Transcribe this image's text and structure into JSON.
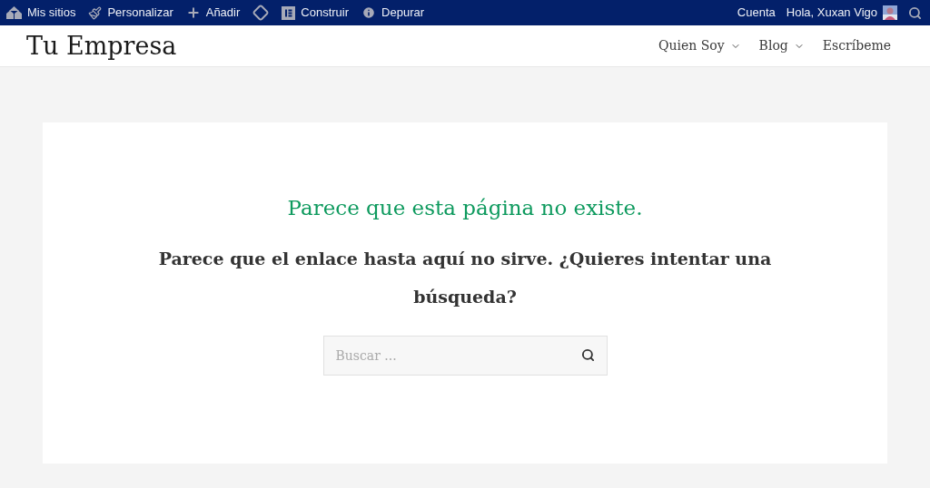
{
  "admin_bar": {
    "left": [
      {
        "kind": "sites",
        "label": "Mis sitios"
      },
      {
        "kind": "brush",
        "label": "Personalizar"
      },
      {
        "kind": "plus",
        "label": "Añadir"
      },
      {
        "kind": "diamond"
      },
      {
        "kind": "builder",
        "label": "Construir"
      },
      {
        "kind": "info",
        "label": "Depurar"
      }
    ],
    "right": [
      {
        "kind": "text",
        "label": "Cuenta"
      },
      {
        "kind": "user",
        "label": "Hola, Xuxan Vigo"
      },
      {
        "kind": "search"
      }
    ]
  },
  "header": {
    "site_title": "Tu Empresa",
    "nav": [
      {
        "label": "Quien Soy",
        "dropdown": true
      },
      {
        "label": "Blog",
        "dropdown": true
      },
      {
        "label": "Escríbeme",
        "dropdown": false
      }
    ]
  },
  "content": {
    "title": "Parece que esta página no existe.",
    "message": "Parece que el enlace hasta aquí no sirve. ¿Quieres intentar una búsqueda?",
    "search": {
      "placeholder": "Buscar ..."
    }
  }
}
